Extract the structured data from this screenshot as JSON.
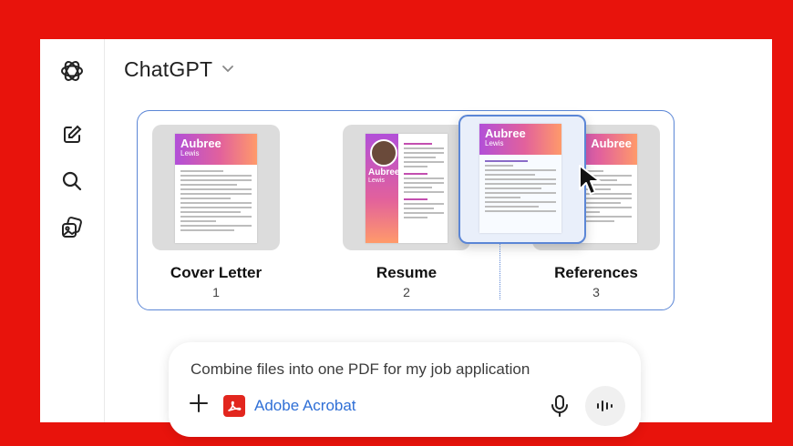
{
  "app": {
    "title": "ChatGPT"
  },
  "sidebar": {
    "icons": [
      "openai-logo-icon",
      "new-chat-icon",
      "search-icon",
      "images-icon"
    ]
  },
  "files": [
    {
      "name": "Cover Letter",
      "number": "1",
      "doc_title": "Aubree",
      "doc_subtitle": "Lewis"
    },
    {
      "name": "Resume",
      "number": "2",
      "doc_title": "Aubree",
      "doc_subtitle": "Lewis"
    },
    {
      "name": "References",
      "number": "3",
      "doc_title": "Aubree",
      "doc_subtitle": "Lewis"
    }
  ],
  "composer": {
    "prompt": "Combine files into one PDF for my job application",
    "tool_label": "Adobe Acrobat"
  },
  "colors": {
    "background": "#e8130c",
    "accent": "#5b86d6",
    "acrobat": "#e2261e"
  }
}
